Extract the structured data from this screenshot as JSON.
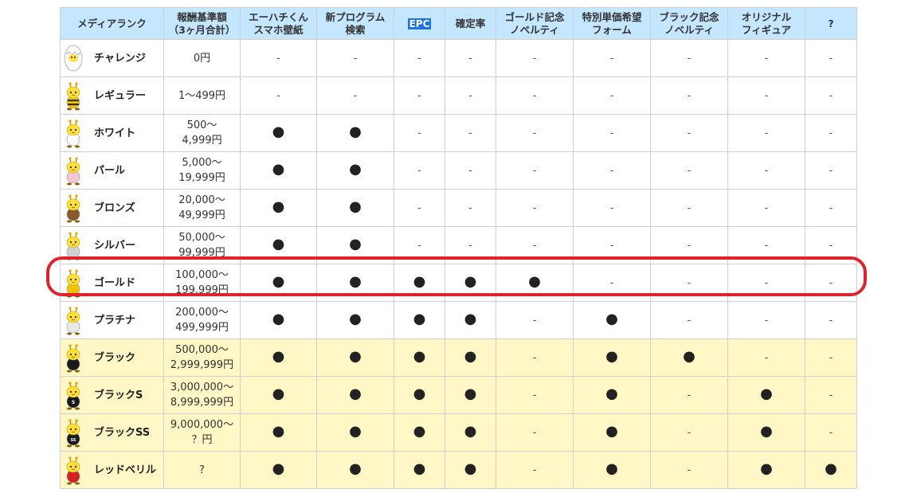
{
  "headers": [
    "メディアランク",
    "報酬基準額\n（3ヶ月合計）",
    "エーハチくん\nスマホ壁紙",
    "新プログラム\n検索",
    "EPC",
    "確定率",
    "ゴールド記念\nノベルティ",
    "特別単価希望\nフォーム",
    "ブラック記念\nノベルティ",
    "オリジナル\nフィギュア",
    "?"
  ],
  "rows": [
    {
      "name": "チャレンジ",
      "amount": "0円",
      "marks": [
        "-",
        "-",
        "-",
        "-",
        "-",
        "-",
        "-",
        "-",
        "-"
      ],
      "mascot": "egg",
      "body": "#ffffff",
      "yellow": false
    },
    {
      "name": "レギュラー",
      "amount": "1〜499円",
      "marks": [
        "-",
        "-",
        "-",
        "-",
        "-",
        "-",
        "-",
        "-",
        "-"
      ],
      "mascot": "bee",
      "body": "#f5c400",
      "stripes": true,
      "yellow": false
    },
    {
      "name": "ホワイト",
      "amount": "500〜\n4,999円",
      "marks": [
        "●",
        "●",
        "-",
        "-",
        "-",
        "-",
        "-",
        "-",
        "-"
      ],
      "mascot": "bee",
      "body": "#ffffff",
      "yellow": false
    },
    {
      "name": "パール",
      "amount": "5,000〜\n19,999円",
      "marks": [
        "●",
        "●",
        "-",
        "-",
        "-",
        "-",
        "-",
        "-",
        "-"
      ],
      "mascot": "bee",
      "body": "#f5c6d2",
      "yellow": false
    },
    {
      "name": "ブロンズ",
      "amount": "20,000〜\n49,999円",
      "marks": [
        "●",
        "●",
        "-",
        "-",
        "-",
        "-",
        "-",
        "-",
        "-"
      ],
      "mascot": "bee",
      "body": "#8a5a2b",
      "yellow": false
    },
    {
      "name": "シルバー",
      "amount": "50,000〜\n99,999円",
      "marks": [
        "●",
        "●",
        "-",
        "-",
        "-",
        "-",
        "-",
        "-",
        "-"
      ],
      "mascot": "bee",
      "body": "#d0d0d0",
      "yellow": false
    },
    {
      "name": "ゴールド",
      "amount": "100,000〜\n199,999円",
      "marks": [
        "●",
        "●",
        "●",
        "●",
        "●",
        "-",
        "-",
        "-",
        "-"
      ],
      "mascot": "bee",
      "body": "#f2c200",
      "yellow": false
    },
    {
      "name": "プラチナ",
      "amount": "200,000〜\n499,999円",
      "marks": [
        "●",
        "●",
        "●",
        "●",
        "-",
        "●",
        "-",
        "-",
        "-"
      ],
      "mascot": "bee",
      "body": "#e8e8e8",
      "yellow": false
    },
    {
      "name": "ブラック",
      "amount": "500,000〜\n2,999,999円",
      "marks": [
        "●",
        "●",
        "●",
        "●",
        "-",
        "●",
        "●",
        "-",
        "-"
      ],
      "mascot": "bee",
      "body": "#1a1a1a",
      "yellow": true
    },
    {
      "name": "ブラックS",
      "amount": "3,000,000〜\n8,999,999円",
      "marks": [
        "●",
        "●",
        "●",
        "●",
        "-",
        "●",
        "-",
        "●",
        "-"
      ],
      "mascot": "bee",
      "body": "#1a1a1a",
      "letter": "S",
      "yellow": true
    },
    {
      "name": "ブラックSS",
      "amount": "9,000,000〜\n？円",
      "marks": [
        "●",
        "●",
        "●",
        "●",
        "-",
        "●",
        "-",
        "●",
        "-"
      ],
      "mascot": "bee",
      "body": "#1a1a1a",
      "letter": "SS",
      "yellow": true
    },
    {
      "name": "レッドベリル",
      "amount": "?",
      "marks": [
        "●",
        "●",
        "●",
        "●",
        "-",
        "●",
        "-",
        "●",
        "●"
      ],
      "mascot": "bee",
      "body": "#d42020",
      "yellow": true
    }
  ],
  "colors": {
    "header_bg": "#c4e6ff",
    "premium_row_bg": "#fff7c6",
    "highlight": "#e0232b",
    "epc_bg": "#1a73e8"
  }
}
